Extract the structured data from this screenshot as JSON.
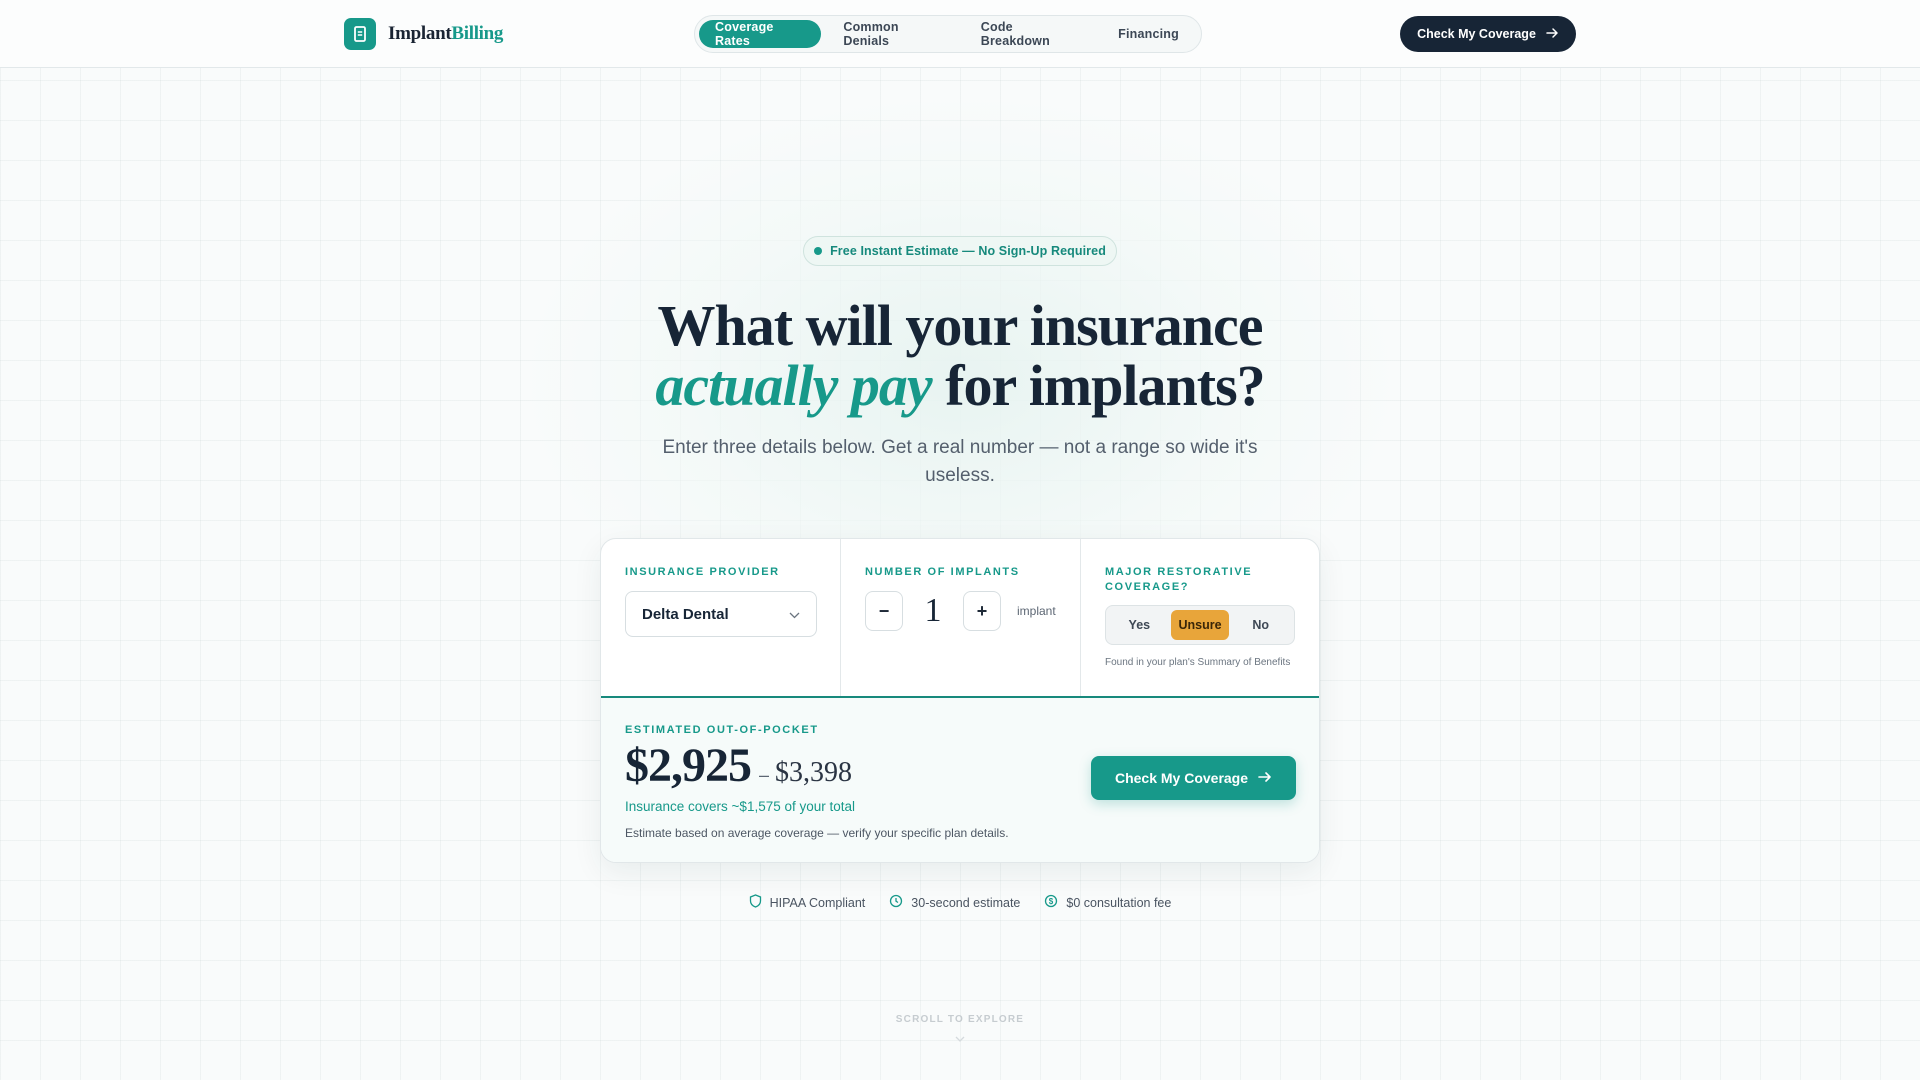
{
  "nav": {
    "logo_part1": "Implant",
    "logo_part2": "Billing",
    "logo_icon": "document-icon",
    "tabs": [
      {
        "label": "Coverage Rates",
        "active": true
      },
      {
        "label": "Common Denials",
        "active": false
      },
      {
        "label": "Code Breakdown",
        "active": false
      },
      {
        "label": "Financing",
        "active": false
      }
    ],
    "cta_label": "Check My Coverage",
    "cta_icon": "arrow-right-icon"
  },
  "hero": {
    "badge": "Free Instant Estimate — No Sign-Up Required",
    "headline_line1": "What will your insurance",
    "headline_accent": "actually pay",
    "headline_rest": " for implants?",
    "subhead": "Enter three details below. Get a real number — not a range so wide it's useless."
  },
  "form": {
    "provider": {
      "label": "INSURANCE PROVIDER",
      "value": "Delta Dental",
      "icon": "chevron-down-icon"
    },
    "implants": {
      "label": "NUMBER OF IMPLANTS",
      "value": "1",
      "unit": "implant",
      "decrement": "−",
      "increment": "+"
    },
    "restorative": {
      "label": "MAJOR RESTORATIVE COVERAGE?",
      "options": [
        "Yes",
        "Unsure",
        "No"
      ],
      "selected": "Unsure",
      "hint": "Found in your plan's Summary of Benefits"
    }
  },
  "result": {
    "label": "ESTIMATED OUT-OF-POCKET",
    "low": "$2,925",
    "dash": "–",
    "high": "$3,398",
    "covers": "Insurance covers ~$1,575 of your total",
    "disclaimer": "Estimate based on average coverage — verify your specific plan details.",
    "cta_label": "Check My Coverage"
  },
  "trust": [
    {
      "label": "HIPAA Compliant",
      "icon": "shield-icon"
    },
    {
      "label": "30-second estimate",
      "icon": "clock-icon"
    },
    {
      "label": "$0 consultation fee",
      "icon": "dollar-icon"
    }
  ],
  "scroll_hint": "SCROLL TO EXPLORE",
  "colors": {
    "accent": "#17998a",
    "dark": "#172536",
    "highlight": "#e8a53a"
  }
}
